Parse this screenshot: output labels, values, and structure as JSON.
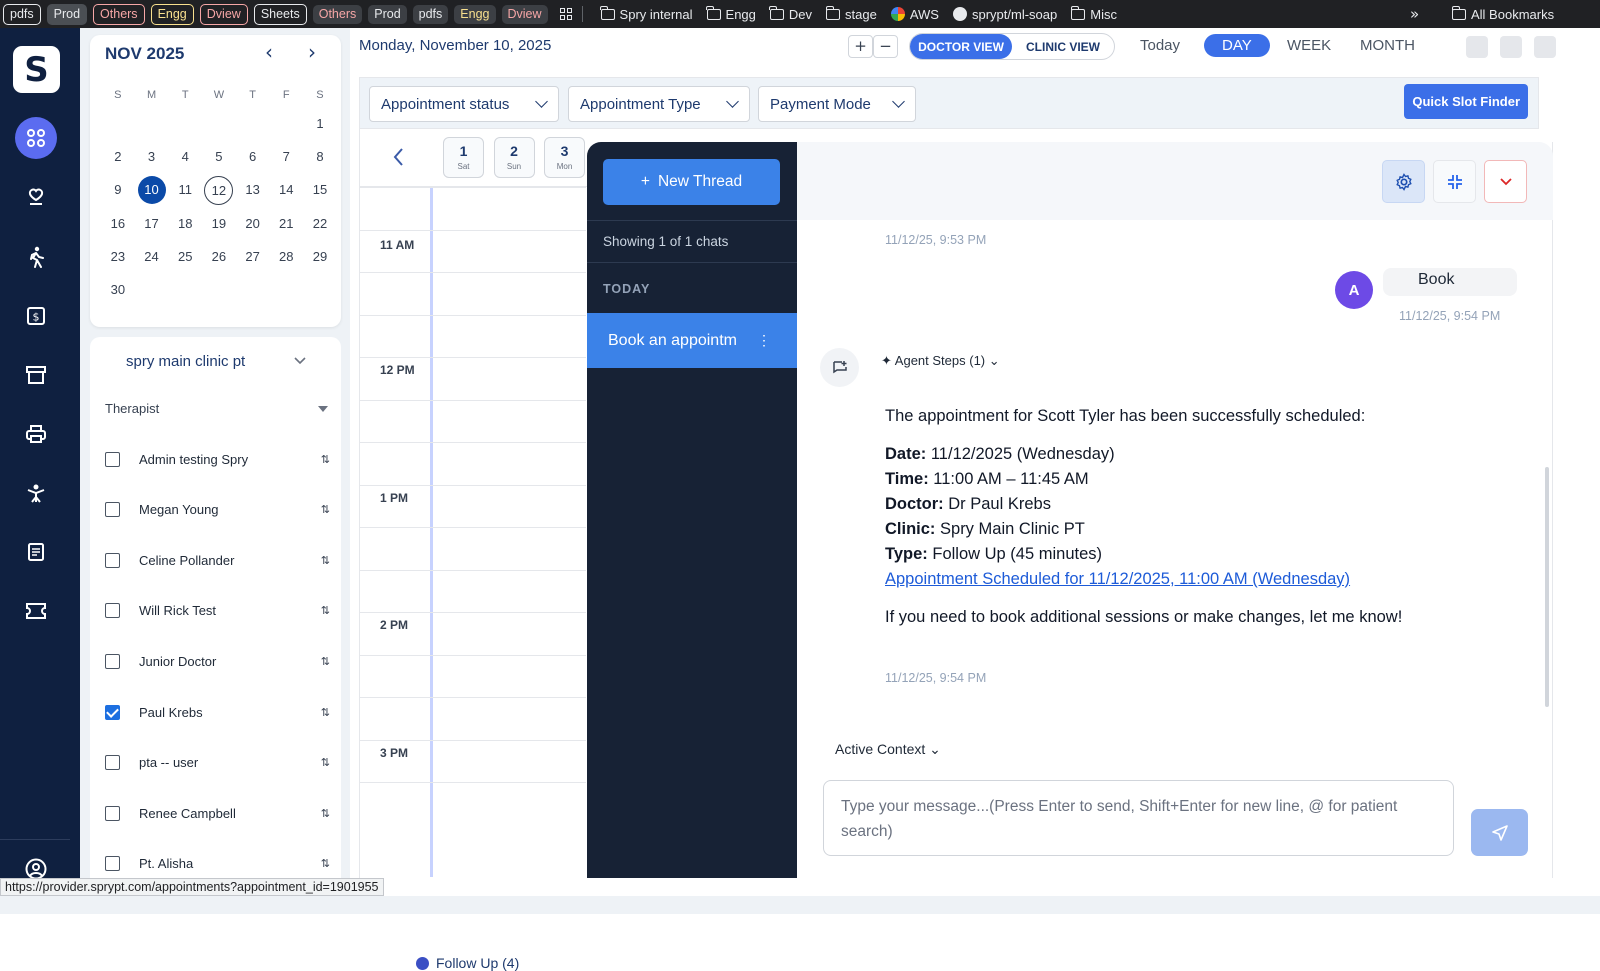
{
  "bookmarks": {
    "pills": [
      {
        "label": "pdfs",
        "style": "bordered"
      },
      {
        "label": "Prod",
        "style": "gray"
      },
      {
        "label": "Others",
        "style": "red"
      },
      {
        "label": "Engg",
        "style": "yel"
      },
      {
        "label": "Dview",
        "style": "red"
      },
      {
        "label": "Sheets",
        "style": "bordered"
      },
      {
        "label": "Others",
        "style": "redtxt"
      },
      {
        "label": "Prod",
        "style": "plain"
      },
      {
        "label": "pdfs",
        "style": "plain"
      },
      {
        "label": "Engg",
        "style": "yeltxt"
      },
      {
        "label": "Dview",
        "style": "redtxt"
      }
    ],
    "folders": [
      "Spry internal",
      "Engg",
      "Dev",
      "stage",
      "AWS",
      "sprypt/ml-soap",
      "Misc"
    ],
    "overflow": "»",
    "all": "All Bookmarks"
  },
  "sidebar": {
    "logo": "S",
    "icons": [
      "dashboard-icon",
      "location-heart-icon",
      "walking-icon",
      "billing-icon",
      "archive-icon",
      "printer-icon",
      "exercise-icon",
      "document-icon",
      "ticket-icon",
      "user-icon"
    ]
  },
  "calendar": {
    "month": "NOV 2025",
    "prev": "‹",
    "next": "›",
    "dow": [
      "S",
      "M",
      "T",
      "W",
      "T",
      "F",
      "S"
    ],
    "days": [
      "",
      "",
      "",
      "",
      "",
      "",
      "1",
      "2",
      "3",
      "4",
      "5",
      "6",
      "7",
      "8",
      "9",
      "10",
      "11",
      "12",
      "13",
      "14",
      "15",
      "16",
      "17",
      "18",
      "19",
      "20",
      "21",
      "22",
      "23",
      "24",
      "25",
      "26",
      "27",
      "28",
      "29",
      "30"
    ],
    "selected": "10",
    "today": "12"
  },
  "clinic": {
    "name": "spry main clinic pt",
    "therapist_label": "Therapist",
    "therapists": [
      {
        "name": "Admin testing Spry",
        "checked": false
      },
      {
        "name": "Megan Young",
        "checked": false
      },
      {
        "name": "Celine Pollander",
        "checked": false
      },
      {
        "name": "Will Rick Test",
        "checked": false
      },
      {
        "name": "Junior Doctor",
        "checked": false
      },
      {
        "name": "Paul Krebs",
        "checked": true
      },
      {
        "name": "pta -- user",
        "checked": false
      },
      {
        "name": "Renee Campbell",
        "checked": false
      },
      {
        "name": "Pt. Alisha",
        "checked": false
      }
    ]
  },
  "header": {
    "date": "Monday, November 10, 2025",
    "zoom_in": "+",
    "zoom_out": "−",
    "doctor_view": "DOCTOR VIEW",
    "clinic_view": "CLINIC VIEW",
    "today": "Today",
    "day": "DAY",
    "week": "WEEK",
    "month": "MONTH"
  },
  "filters": {
    "status": "Appointment status",
    "type": "Appointment Type",
    "payment": "Payment Mode",
    "quick": "Quick Slot Finder"
  },
  "daystrip": [
    {
      "d": "1",
      "w": "Sat"
    },
    {
      "d": "2",
      "w": "Sun"
    },
    {
      "d": "3",
      "w": "Mon"
    }
  ],
  "times": [
    "11 AM",
    "12 PM",
    "1 PM",
    "2 PM",
    "3 PM"
  ],
  "legend": "Follow Up (4)",
  "threads": {
    "new_label": "New Thread",
    "new_plus": "+",
    "showing": "Showing 1 of 1 chats",
    "group": "TODAY",
    "item": "Book an appointm",
    "item_menu": "⋮"
  },
  "chat": {
    "ts_top": "11/12/25, 9:53 PM",
    "avatar": "A",
    "user_msg": "Book",
    "ts_user": "11/12/25, 9:54 PM",
    "agent_steps": "Agent Steps (1)",
    "intro": "The appointment for Scott Tyler has been successfully scheduled:",
    "date_k": "Date:",
    "date_v": " 11/12/2025 (Wednesday)",
    "time_k": "Time:",
    "time_v": " 11:00 AM – 11:45 AM",
    "doctor_k": "Doctor:",
    "doctor_v": " Dr Paul Krebs",
    "clinic_k": "Clinic:",
    "clinic_v": " Spry Main Clinic PT",
    "type_k": "Type:",
    "type_v": " Follow Up (45 minutes)",
    "link": "Appointment Scheduled for 11/12/2025, 11:00 AM (Wednesday)",
    "outro": "If you need to book additional sessions or make changes, let me know!",
    "ts_bot": "11/12/25, 9:54 PM",
    "active_context": "Active Context",
    "placeholder": "Type your message...(Press Enter to send, Shift+Enter for new line, @ for patient search)"
  },
  "status_url": "https://provider.sprypt.com/appointments?appointment_id=1901955"
}
